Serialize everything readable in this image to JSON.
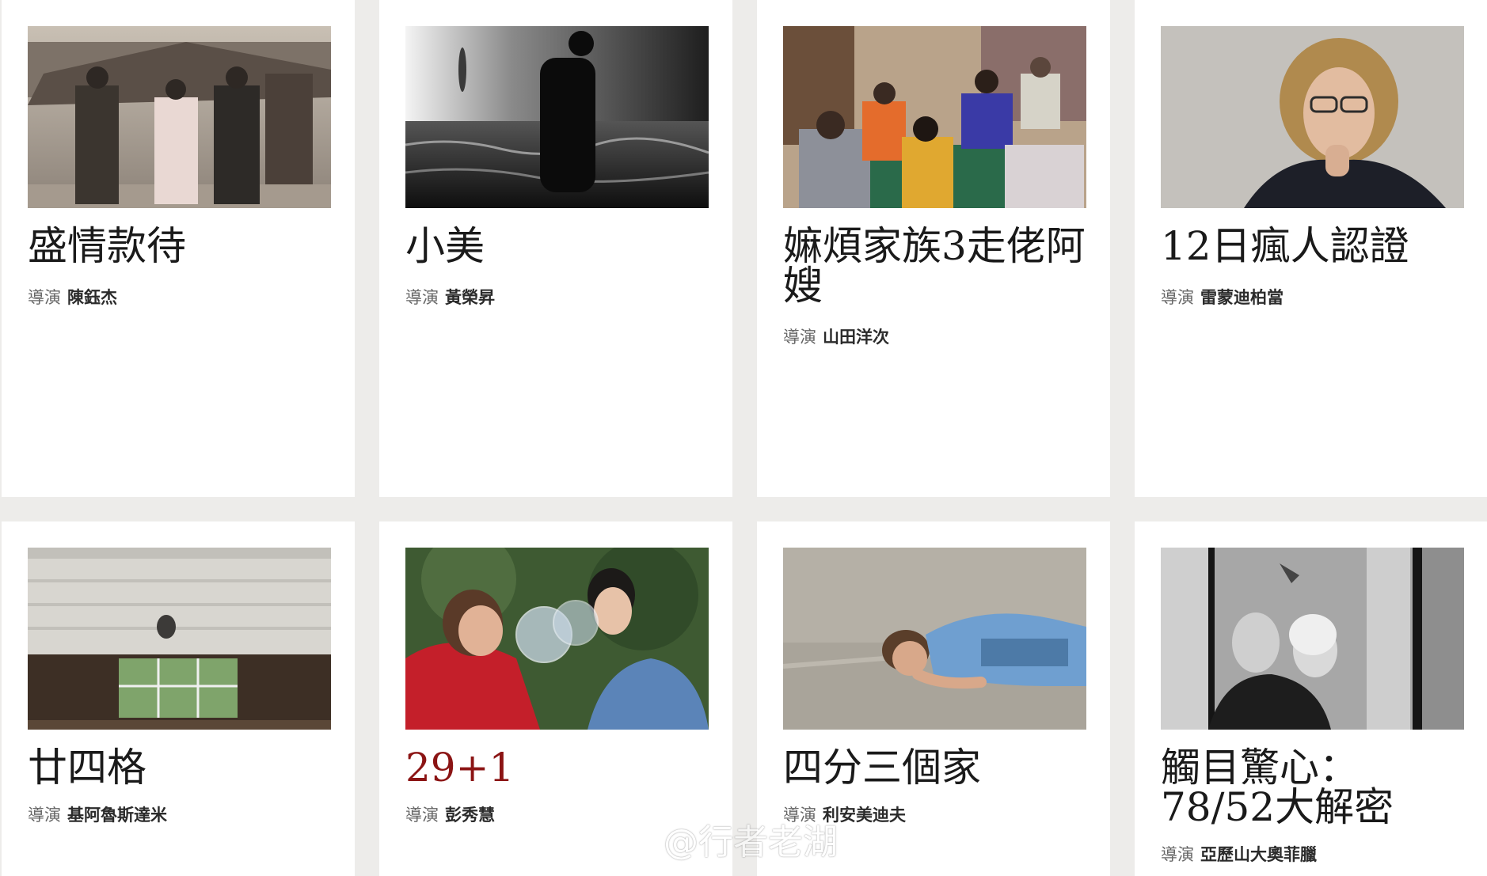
{
  "director_label": "導演",
  "films": [
    {
      "title": "盛情款待",
      "director": "陳鈺杰"
    },
    {
      "title": "小美",
      "director": "黃榮昇"
    },
    {
      "title": "嫲煩家族3走佬阿嫂",
      "director": "山田洋次"
    },
    {
      "title": "12日瘋人認證",
      "director": "雷蒙迪柏當"
    },
    {
      "title": "廿四格",
      "director": "基阿魯斯達米"
    },
    {
      "title": "29+1",
      "director": "彭秀慧"
    },
    {
      "title": "四分三個家",
      "director": "利安美迪夫"
    },
    {
      "title": "觸目驚心：78/52大解密",
      "director": "亞歷山大奧菲臘"
    }
  ],
  "watermark": {
    "text": "@行者老湖"
  },
  "colors": {
    "background": "#edecea",
    "card": "#ffffff",
    "accent_title": "#8b1414"
  }
}
